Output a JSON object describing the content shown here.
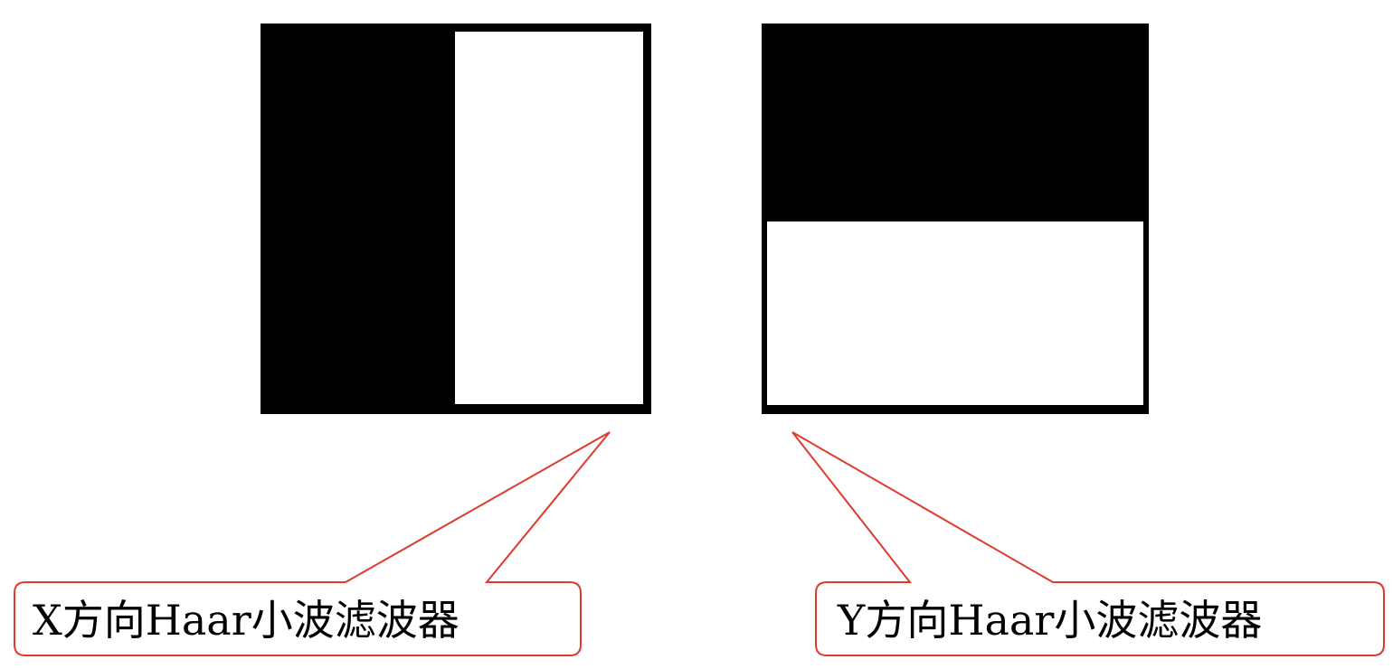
{
  "labels": {
    "x_filter": "X方向Haar小波滤波器",
    "y_filter": "Y方向Haar小波滤波器"
  },
  "colors": {
    "dark": "#000000",
    "light": "#ffffff",
    "callout_border": "#e03a2e"
  }
}
